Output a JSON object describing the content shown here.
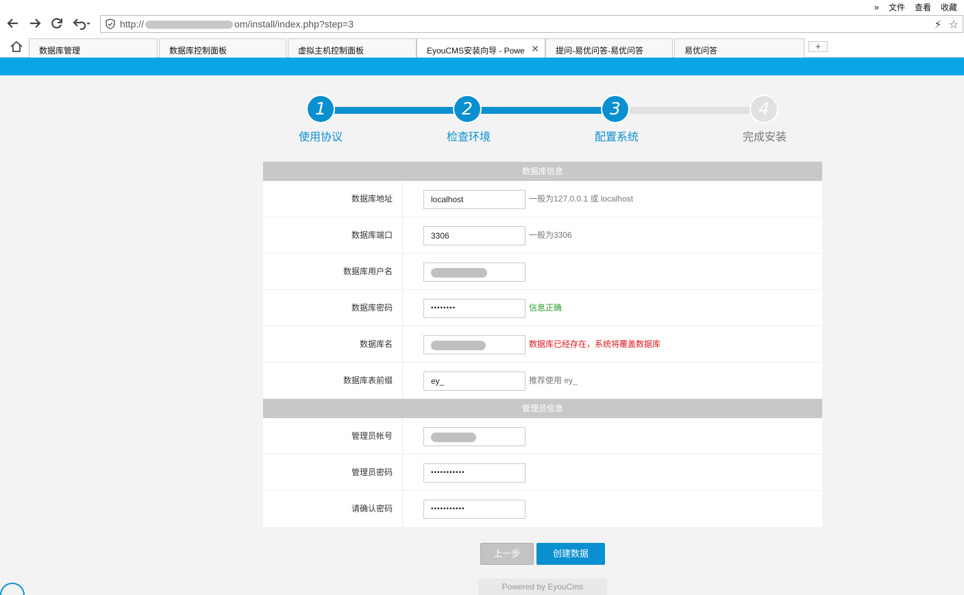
{
  "browser": {
    "menu": {
      "more": "»",
      "file": "文件",
      "view": "查看",
      "favorites": "收藏"
    },
    "url": {
      "prefix": "http://",
      "suffix": "om/install/index.php?step=3"
    },
    "tabs": [
      {
        "label": "数据库管理"
      },
      {
        "label": "数据库控制面板"
      },
      {
        "label": "虚拟主机控制面板"
      },
      {
        "label": "EyouCMS安装向导 - Powe"
      },
      {
        "label": "提问-易优问答-易优问答"
      },
      {
        "label": "易优问答"
      }
    ],
    "new_tab": "+"
  },
  "steps": [
    {
      "num": "1",
      "label": "使用协议",
      "state": "done"
    },
    {
      "num": "2",
      "label": "检查环境",
      "state": "done"
    },
    {
      "num": "3",
      "label": "配置系统",
      "state": "done"
    },
    {
      "num": "4",
      "label": "完成安装",
      "state": "todo"
    }
  ],
  "db_section": {
    "title": "数据库信息",
    "rows": [
      {
        "label": "数据库地址",
        "value": "localhost",
        "hint": "一般为127.0.0.1 或 localhost"
      },
      {
        "label": "数据库端口",
        "value": "3306",
        "hint": "一般为3306"
      },
      {
        "label": "数据库用户名",
        "value": "",
        "hint": ""
      },
      {
        "label": "数据库密码",
        "value": "••••••••",
        "hint": "信息正确"
      },
      {
        "label": "数据库名",
        "value": "",
        "hint": "数据库已经存在，系统将覆盖数据库"
      },
      {
        "label": "数据库表前缀",
        "value": "ey_",
        "hint": "推荐使用 ey_"
      }
    ]
  },
  "admin_section": {
    "title": "管理员信息",
    "rows": [
      {
        "label": "管理员帐号",
        "value": ""
      },
      {
        "label": "管理员密码",
        "value": "•••••••••••"
      },
      {
        "label": "请确认密码",
        "value": "•••••••••••"
      }
    ]
  },
  "buttons": {
    "prev": "上一步",
    "next": "创建数据"
  },
  "footer": {
    "powered": "Powered by EyouCms"
  },
  "colors": {
    "accent": "#0a8fd0",
    "band": "#0aa5e7",
    "ok": "#2a9d2a",
    "warn": "#e0151b"
  }
}
